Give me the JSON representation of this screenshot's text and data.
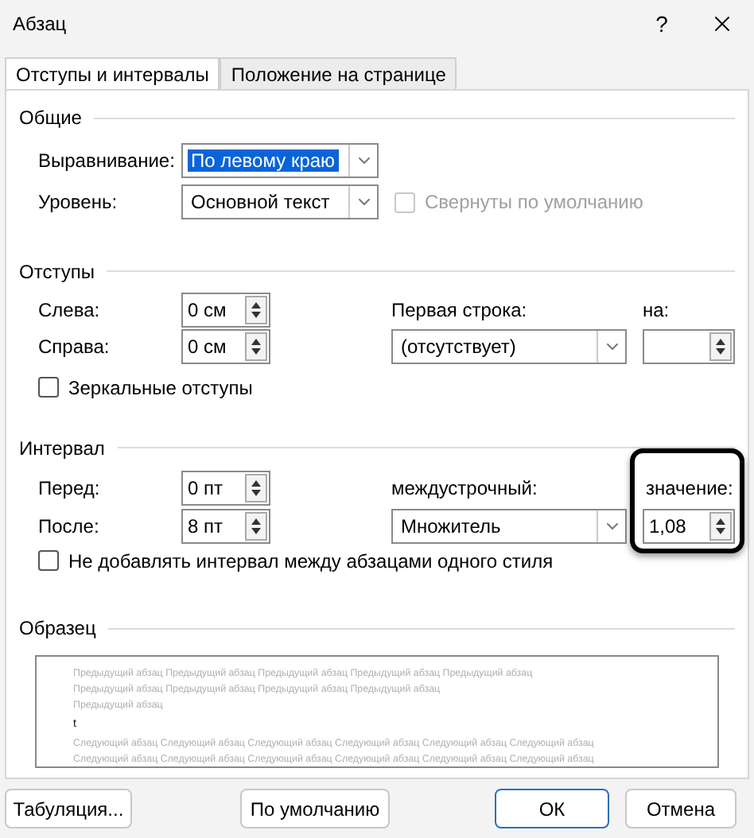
{
  "window": {
    "title": "Абзац",
    "help": "?"
  },
  "tabs": [
    {
      "label": "Отступы и интервалы",
      "selected": true
    },
    {
      "label": "Положение на странице",
      "selected": false
    }
  ],
  "general": {
    "title": "Общие",
    "alignment": {
      "label": "Выравнивание:",
      "value": "По левому краю",
      "selected": true
    },
    "level": {
      "label": "Уровень:",
      "value": "Основной текст",
      "selected": false
    },
    "collapsed": {
      "label": "Свернуты по умолчанию",
      "checked": false,
      "disabled": true
    }
  },
  "indents": {
    "title": "Отступы",
    "left": {
      "label": "Слева:",
      "value": "0 см"
    },
    "right": {
      "label": "Справа:",
      "value": "0 см"
    },
    "first_line": {
      "label": "Первая строка:",
      "value": "(отсутствует)"
    },
    "by": {
      "label": "на:"
    },
    "mirror": {
      "label": "Зеркальные отступы",
      "checked": false
    }
  },
  "spacing": {
    "title": "Интервал",
    "before": {
      "label": "Перед:",
      "value": "0 пт"
    },
    "after": {
      "label": "После:",
      "value": "8 пт"
    },
    "line_spacing": {
      "label": "междустрочный:",
      "value": "Множитель"
    },
    "at": {
      "label": "значение:",
      "value": "1,08",
      "highlighted": true
    },
    "dont_add": {
      "label": "Не добавлять интервал между абзацами одного стиля",
      "checked": false
    }
  },
  "preview": {
    "title": "Образец",
    "previous_lines": [
      "Предыдущий абзац Предыдущий абзац Предыдущий абзац Предыдущий абзац Предыдущий абзац",
      "Предыдущий абзац Предыдущий абзац Предыдущий абзац Предыдущий абзац",
      "Предыдущий абзац"
    ],
    "text": "t",
    "next_lines": [
      "Следующий абзац Следующий абзац Следующий абзац Следующий абзац Следующий абзац Следующий абзац",
      "Следующий абзац Следующий абзац Следующий абзац Следующий абзац Следующий абзац Следующий абзац"
    ]
  },
  "buttons": [
    {
      "label": "Табуляция...",
      "default": false
    },
    {
      "label": "По умолчанию",
      "default": false
    },
    {
      "label": "ОК",
      "default": true
    },
    {
      "label": "Отмена",
      "default": false
    }
  ]
}
